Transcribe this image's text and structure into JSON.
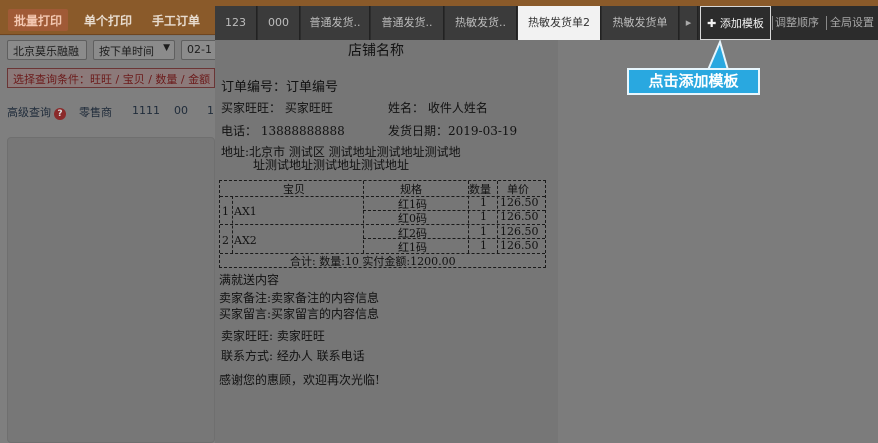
{
  "app_tabs": [
    {
      "label": "批量打印"
    },
    {
      "label": "单个打印"
    },
    {
      "label": "手工订单"
    }
  ],
  "filters": {
    "shop": "北京莫乐融融",
    "time": "按下单时间",
    "date": "02-1",
    "condition": "选择查询条件：旺旺 / 宝贝 / 数量 / 金额"
  },
  "query_row": {
    "advanced": "高级查询",
    "retail": "零售商",
    "v1": "1111",
    "v2": "00",
    "v3": "1"
  },
  "template_tabs": [
    {
      "label": "123"
    },
    {
      "label": "000"
    },
    {
      "label": "普通发货.."
    },
    {
      "label": "普通发货.."
    },
    {
      "label": "热敏发货.."
    },
    {
      "label": "热敏发货单2"
    },
    {
      "label": "热敏发货单"
    },
    {
      "label": "▸"
    }
  ],
  "top_actions": {
    "add_template": "✚ 添加模板",
    "adjust_order": "调整顺序",
    "global_settings": "全局设置"
  },
  "callout": "点击添加模板",
  "receipt": {
    "shop_name": "店铺名称",
    "order_no": "订单编号：订单编号",
    "buyer": "买家旺旺：  买家旺旺",
    "name": "姓名：   收件人姓名",
    "phone": "电话：    13888888888",
    "ship_date": "发货日期：2019-03-19",
    "address_1": "地址:北京市 测试区 测试地址测试地址测试地",
    "address_2": "址测试地址测试地址测试地址",
    "table": {
      "headers": [
        "宝贝",
        "规格",
        "数量",
        "单价"
      ],
      "rows": [
        {
          "idx": "1",
          "item": "AX1",
          "spec": "红1码",
          "qty": "1",
          "price": "126.50"
        },
        {
          "idx": "",
          "item": "",
          "spec": "红0码",
          "qty": "1",
          "price": "126.50"
        },
        {
          "idx": "2",
          "item": "AX2",
          "spec": "红2码",
          "qty": "1",
          "price": "126.50"
        },
        {
          "idx": "",
          "item": "",
          "spec": "红1码",
          "qty": "1",
          "price": "126.50"
        }
      ],
      "total": "合计:  数量:10  实付金额:1200.00"
    },
    "gift": "满就送内容",
    "seller_note": "卖家备注:卖家备注的内容信息",
    "buyer_msg": "买家留言:买家留言的内容信息",
    "seller_ww": "卖家旺旺: 卖家旺旺",
    "contact": "联系方式: 经办人  联系电话",
    "thanks": "感谢您的惠顾，欢迎再次光临!"
  },
  "colors": {
    "callout_bg": "#29a8e0",
    "topbar": "#8a5a2a",
    "overlay": "#7a7a7a"
  }
}
